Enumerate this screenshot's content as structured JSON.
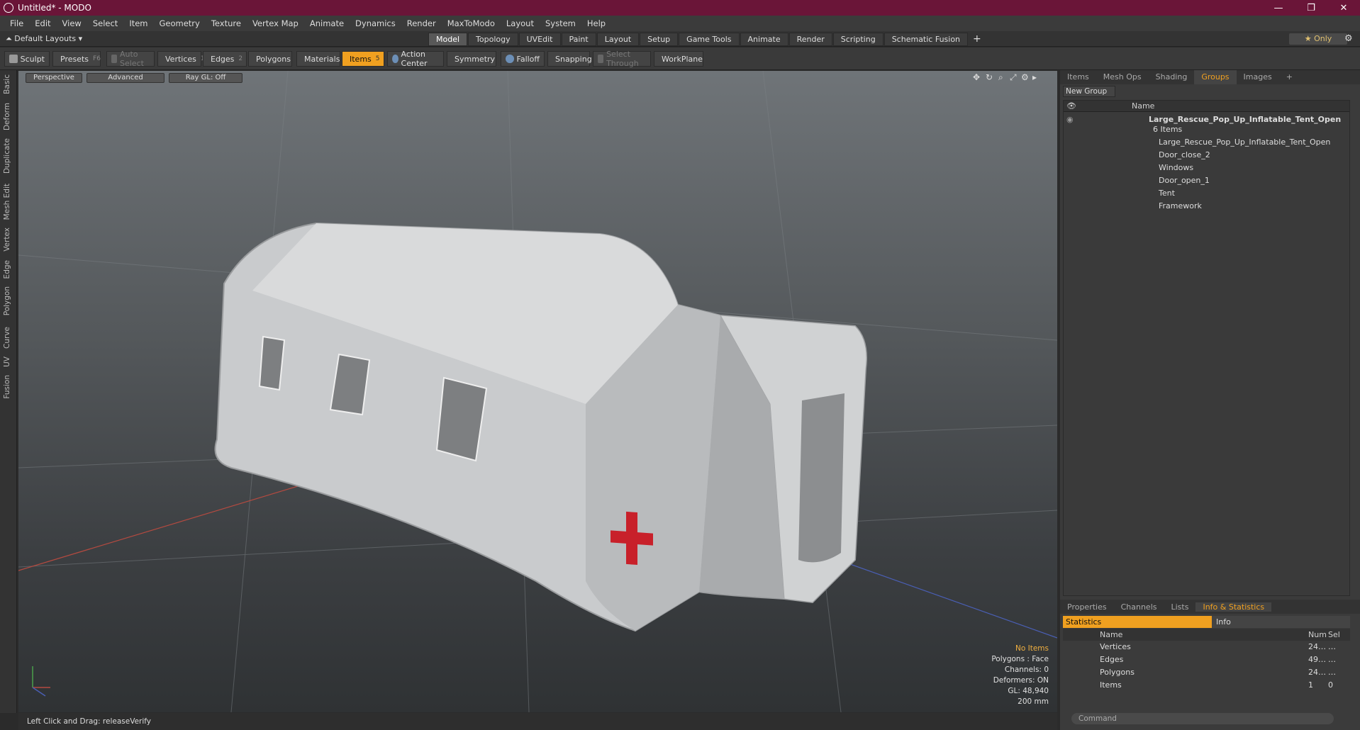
{
  "window": {
    "title": "Untitled* - MODO"
  },
  "menu": [
    "File",
    "Edit",
    "View",
    "Select",
    "Item",
    "Geometry",
    "Texture",
    "Vertex Map",
    "Animate",
    "Dynamics",
    "Render",
    "MaxToModo",
    "Layout",
    "System",
    "Help"
  ],
  "layout": {
    "label": "Default Layouts ▾"
  },
  "tabs": [
    "Model",
    "Topology",
    "UVEdit",
    "Paint",
    "Layout",
    "Setup",
    "Game Tools",
    "Animate",
    "Render",
    "Scripting",
    "Schematic Fusion"
  ],
  "only_label": "★  Only",
  "toolbar": {
    "sculpt": "Sculpt",
    "presets": "Presets",
    "presets_key": "F6",
    "auto_select": "Auto Select",
    "vertices": "Vertices",
    "vertices_num": "1",
    "edges": "Edges",
    "edges_num": "2",
    "polygons": "Polygons",
    "materials": "Materials",
    "items": "Items",
    "items_num": "5",
    "action_center": "Action Center",
    "symmetry": "Symmetry",
    "falloff": "Falloff",
    "snapping": "Snapping",
    "select_through": "Select Through",
    "workplane": "WorkPlane"
  },
  "left_tabs": [
    "Basic",
    "Deform",
    "Duplicate",
    "Mesh Edit",
    "Vertex",
    "Edge",
    "Polygon",
    "Curve",
    "UV",
    "Fusion"
  ],
  "viewport": {
    "perspective": "Perspective",
    "advanced": "Advanced",
    "raygl": "Ray GL: Off",
    "stats": {
      "no_items": "No Items",
      "polygons": "Polygons : Face",
      "channels": "Channels: 0",
      "deformers": "Deformers: ON",
      "gl": "GL: 48,940",
      "scale": "200 mm"
    }
  },
  "status": {
    "text": "Left Click and Drag:  releaseVerify"
  },
  "right_tabs": [
    "Items",
    "Mesh Ops",
    "Shading",
    "Groups",
    "Images"
  ],
  "groups": {
    "new_group": "New Group",
    "col_name": "Name",
    "root": {
      "name": "Large_Rescue_Pop_Up_Inflatable_Tent_Open",
      "count": "6 Items"
    },
    "children": [
      "Large_Rescue_Pop_Up_Inflatable_Tent_Open",
      "Door_close_2",
      "Windows",
      "Door_open_1",
      "Tent",
      "Framework"
    ]
  },
  "bottom_tabs": [
    "Properties",
    "Channels",
    "Lists",
    "Info & Statistics"
  ],
  "statistics": {
    "tab_stats": "Statistics",
    "tab_info": "Info",
    "col_name": "Name",
    "col_num": "Num",
    "col_sel": "Sel",
    "rows": [
      {
        "name": "Vertices",
        "num": "24…",
        "sel": "…"
      },
      {
        "name": "Edges",
        "num": "49…",
        "sel": "…"
      },
      {
        "name": "Polygons",
        "num": "24…",
        "sel": "…"
      },
      {
        "name": "Items",
        "num": "1",
        "sel": "0"
      }
    ]
  },
  "command": {
    "placeholder": "Command"
  },
  "colors": {
    "titlebar": "#6a1538",
    "accent": "#f0a020",
    "cross": "#c8202a"
  }
}
